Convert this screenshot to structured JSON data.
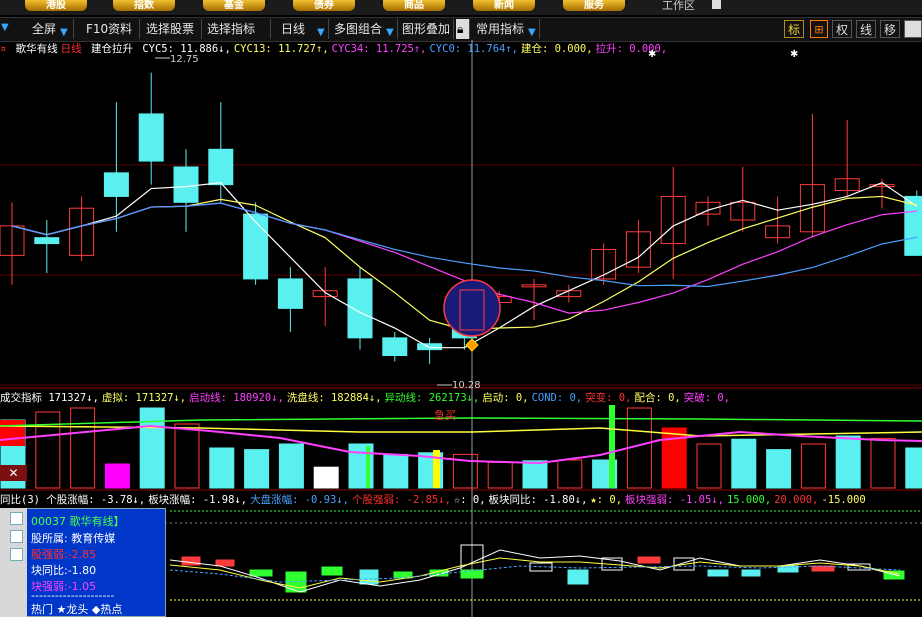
{
  "topnav": {
    "items": [
      "港股",
      "指数",
      "基金",
      "债券",
      "商品",
      "新闻",
      "服务"
    ],
    "workarea": "工作区"
  },
  "toolbar": {
    "items": [
      "全屏",
      "F10资料",
      "选择股票",
      "选择指标",
      "日线",
      "多图组合",
      "图形叠加",
      "常用指标"
    ],
    "right": [
      "标",
      "⊞",
      "权",
      "线",
      "移"
    ]
  },
  "main_legend": {
    "name": "歌华有线",
    "period": "日线",
    "indicator": "建仓拉升",
    "items": [
      {
        "text": "CYC5: 11.886↓,",
        "color": "#ffffff"
      },
      {
        "text": "CYC13: 11.727↑,",
        "color": "#ffff60"
      },
      {
        "text": "CYC34: 11.725↑,",
        "color": "#ff40ff"
      },
      {
        "text": "CYC0: 11.764↑,",
        "color": "#4aa0ff"
      },
      {
        "text": "建仓: 0.000,",
        "color": "#ffff60"
      },
      {
        "text": "拉升: 0.000,",
        "color": "#ff40ff"
      }
    ],
    "high_label": "12.75",
    "low_label": "10.28"
  },
  "volume_legend": {
    "items": [
      {
        "text": "成交指标 171327↓,",
        "color": "#ffffff"
      },
      {
        "text": "虚拟: 171327↓,",
        "color": "#ffff60"
      },
      {
        "text": "启动线: 180920↓,",
        "color": "#ff40ff"
      },
      {
        "text": "洗盘线: 182884↓,",
        "color": "#ffff60"
      },
      {
        "text": "异动线: 262173↓,",
        "color": "#30ff30"
      },
      {
        "text": "启动: 0,",
        "color": "#ffff60"
      },
      {
        "text": "COND: 0,",
        "color": "#40a0ff"
      },
      {
        "text": "突变: 0,",
        "color": "#ff3030"
      },
      {
        "text": "配合: 0,",
        "color": "#ffff60"
      },
      {
        "text": "突破: 0,",
        "color": "#ff40ff"
      }
    ],
    "signal": "急买"
  },
  "sector_legend": {
    "items": [
      {
        "text": "同比(3) 个股涨幅: -3.78↓,",
        "color": "#ffffff"
      },
      {
        "text": "板块涨幅: -1.98↓,",
        "color": "#ffffff"
      },
      {
        "text": "大盘涨幅: -0.93↓,",
        "color": "#4aa0ff"
      },
      {
        "text": "个股强弱: -2.85↓,",
        "color": "#ff3030"
      },
      {
        "text": "☆: 0,",
        "color": "#ffffff"
      },
      {
        "text": "板块同比: -1.80↓,",
        "color": "#ffffff"
      },
      {
        "text": "★: 0,",
        "color": "#ffff60"
      },
      {
        "text": "板块强弱: -1.05↓,",
        "color": "#ff40ff"
      },
      {
        "text": "15.000,",
        "color": "#30ff30"
      },
      {
        "text": "20.000,",
        "color": "#ff3030"
      },
      {
        "text": "-15.000",
        "color": "#ffff60"
      }
    ]
  },
  "infobox": {
    "code": "00037 歌华有线】",
    "sector": "股所属: 教育传媒",
    "strength": "股强弱:-2.85",
    "block_yoy": "块同比:-1.80",
    "block_strength": "块强弱:-1.05",
    "dashes": "---------------------",
    "footer": "热门 ★龙头 ◆热点"
  },
  "chart_data": {
    "type": "candlestick",
    "candles": [
      {
        "o": 11.2,
        "h": 11.65,
        "l": 10.95,
        "c": 11.45
      },
      {
        "o": 11.35,
        "h": 11.5,
        "l": 11.05,
        "c": 11.3
      },
      {
        "o": 11.2,
        "h": 11.7,
        "l": 11.15,
        "c": 11.6
      },
      {
        "o": 11.9,
        "h": 12.5,
        "l": 11.4,
        "c": 11.7
      },
      {
        "o": 12.4,
        "h": 12.75,
        "l": 11.8,
        "c": 12.0
      },
      {
        "o": 11.95,
        "h": 12.1,
        "l": 11.4,
        "c": 11.65
      },
      {
        "o": 12.1,
        "h": 12.5,
        "l": 11.65,
        "c": 11.8
      },
      {
        "o": 11.55,
        "h": 11.65,
        "l": 10.95,
        "c": 11.0
      },
      {
        "o": 11.0,
        "h": 11.1,
        "l": 10.55,
        "c": 10.75
      },
      {
        "o": 10.85,
        "h": 11.1,
        "l": 10.6,
        "c": 10.9
      },
      {
        "o": 11.0,
        "h": 11.1,
        "l": 10.4,
        "c": 10.5
      },
      {
        "o": 10.5,
        "h": 10.55,
        "l": 10.3,
        "c": 10.35
      },
      {
        "o": 10.45,
        "h": 10.5,
        "l": 10.28,
        "c": 10.4
      },
      {
        "o": 10.8,
        "h": 10.9,
        "l": 10.4,
        "c": 10.5
      },
      {
        "o": 10.8,
        "h": 10.9,
        "l": 10.8,
        "c": 10.85
      },
      {
        "o": 10.95,
        "h": 11.0,
        "l": 10.65,
        "c": 10.95
      },
      {
        "o": 10.85,
        "h": 10.95,
        "l": 10.8,
        "c": 10.9
      },
      {
        "o": 11.0,
        "h": 11.3,
        "l": 10.95,
        "c": 11.25
      },
      {
        "o": 11.1,
        "h": 11.5,
        "l": 11.05,
        "c": 11.4
      },
      {
        "o": 11.3,
        "h": 11.95,
        "l": 11.0,
        "c": 11.7
      },
      {
        "o": 11.55,
        "h": 11.7,
        "l": 11.45,
        "c": 11.65
      },
      {
        "o": 11.5,
        "h": 11.95,
        "l": 11.4,
        "c": 11.65
      },
      {
        "o": 11.35,
        "h": 11.7,
        "l": 11.3,
        "c": 11.45
      },
      {
        "o": 11.4,
        "h": 12.4,
        "l": 11.35,
        "c": 11.8
      },
      {
        "o": 11.75,
        "h": 12.35,
        "l": 11.7,
        "c": 11.85
      },
      {
        "o": 11.8,
        "h": 11.85,
        "l": 11.6,
        "c": 11.8
      },
      {
        "o": 11.7,
        "h": 11.75,
        "l": 11.2,
        "c": 11.2
      }
    ],
    "ylim": [
      10.1,
      12.9
    ],
    "volumes": [
      {
        "v": 0.85,
        "up": false
      },
      {
        "v": 0.95,
        "up": true
      },
      {
        "v": 1.0,
        "up": true
      },
      {
        "v": 0.3,
        "up": true,
        "color": "#ff00ff"
      },
      {
        "v": 1.0,
        "up": false
      },
      {
        "v": 0.8,
        "up": true
      },
      {
        "v": 0.5,
        "up": false
      },
      {
        "v": 0.48,
        "up": false
      },
      {
        "v": 0.55,
        "up": false
      },
      {
        "v": 0.26,
        "up": false,
        "color": "#ffffff"
      },
      {
        "v": 0.55,
        "up": false
      },
      {
        "v": 0.42,
        "up": false
      },
      {
        "v": 0.44,
        "up": false
      },
      {
        "v": 0.42,
        "up": true
      },
      {
        "v": 0.32,
        "up": true
      },
      {
        "v": 0.34,
        "up": false
      },
      {
        "v": 0.35,
        "up": true
      },
      {
        "v": 0.35,
        "up": false
      },
      {
        "v": 1.0,
        "up": true
      },
      {
        "v": 0.75,
        "up": true,
        "color": "#ff0000"
      },
      {
        "v": 0.55,
        "up": true
      },
      {
        "v": 0.61,
        "up": false
      },
      {
        "v": 0.48,
        "up": false
      },
      {
        "v": 0.55,
        "up": true
      },
      {
        "v": 0.65,
        "up": false
      },
      {
        "v": 0.62,
        "up": true
      },
      {
        "v": 0.5,
        "up": false
      }
    ]
  }
}
